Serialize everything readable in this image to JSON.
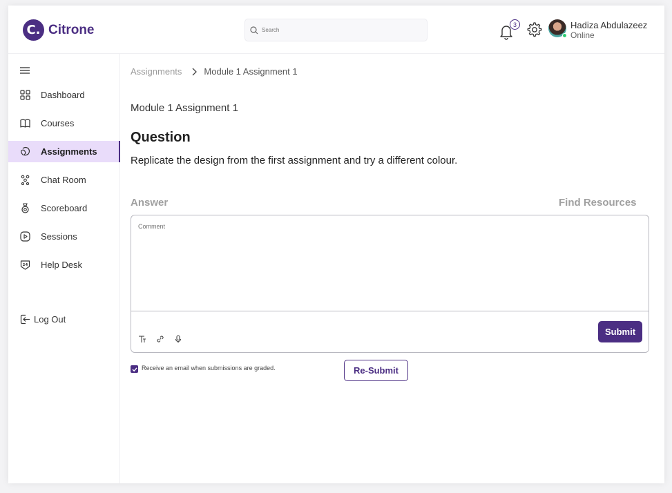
{
  "brand": {
    "logo_letter": "C.",
    "name": "Citrone",
    "color": "#4b2e83"
  },
  "header": {
    "search_placeholder": "Search",
    "notifications_count": "3",
    "user_name": "Hadiza Abdulazeez",
    "user_status": "Online"
  },
  "sidebar": {
    "items": [
      {
        "label": "Dashboard",
        "icon": "grid-icon"
      },
      {
        "label": "Courses",
        "icon": "book-icon"
      },
      {
        "label": "Assignments",
        "icon": "assignment-icon",
        "active": true
      },
      {
        "label": "Chat Room",
        "icon": "chat-icon"
      },
      {
        "label": "Scoreboard",
        "icon": "scoreboard-icon"
      },
      {
        "label": "Sessions",
        "icon": "play-icon"
      },
      {
        "label": "Help Desk",
        "icon": "help-24-icon"
      }
    ],
    "logout_label": "Log Out"
  },
  "breadcrumb": {
    "parent": "Assignments",
    "current": "Module 1 Assignment 1"
  },
  "main": {
    "title": "Module 1 Assignment 1",
    "question_heading": "Question",
    "question_text": "Replicate the design from the first assignment and try a different colour.",
    "answer_label": "Answer",
    "find_resources_label": "Find Resources",
    "comment_placeholder": "Comment",
    "submit_label": "Submit",
    "email_checkbox_label": "Receive an email when submissions are graded.",
    "email_checkbox_checked": true,
    "resubmit_label": "Re-Submit"
  }
}
